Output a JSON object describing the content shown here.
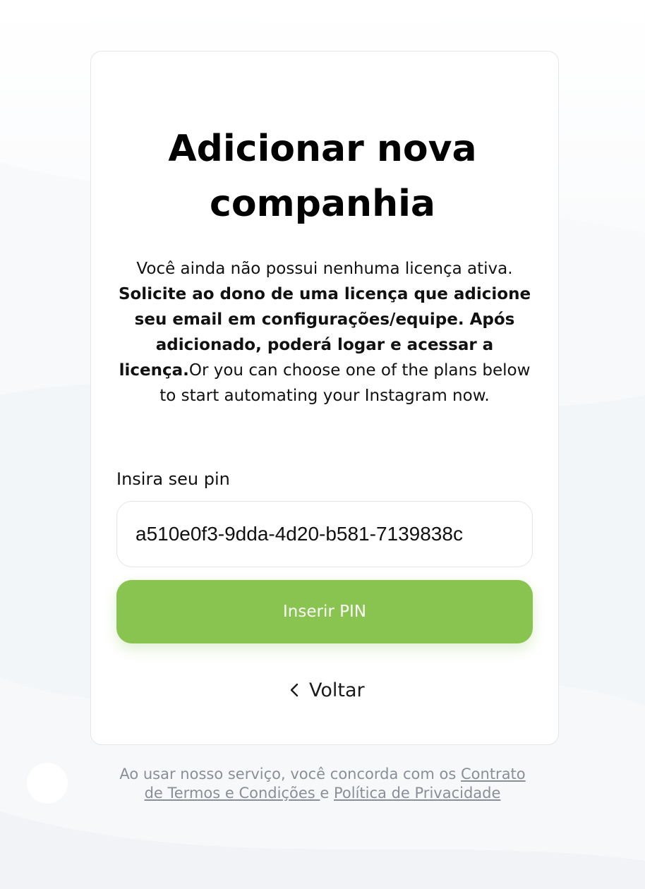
{
  "header": {
    "title": "Adicionar nova companhia"
  },
  "description": {
    "intro": "Você ainda não possui nenhuma licença ativa. ",
    "bold": "Solicite ao dono de uma licença que adicione seu email em configurações/equipe. Após adicionado, poderá logar e acessar a licença.",
    "outro": "Or you can choose one of the plans below to start automating your Instagram now."
  },
  "pin": {
    "label": "Insira seu pin",
    "value": "a510e0f3-9dda-4d20-b581-7139838c"
  },
  "actions": {
    "submit_label": "Inserir PIN",
    "back_label": "Voltar"
  },
  "footer": {
    "text": "Ao usar nosso serviço, você concorda com os ",
    "terms_link": "Contrato de Termos e Condições ",
    "connector": "e",
    "privacy_link": "Política de Privacidade"
  },
  "colors": {
    "accent": "#88c44f",
    "card_border": "#e3e6ea",
    "footer_text": "#8a8f96"
  },
  "icons": {
    "back": "chevron-left-icon",
    "chat": "chat-bubble-icon"
  }
}
